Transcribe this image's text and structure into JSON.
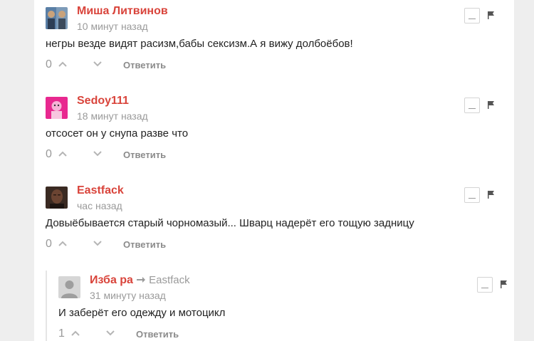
{
  "comments": [
    {
      "author": "Миша Литвинов",
      "time": "10 минут назад",
      "text": "негры везде видят расизм,бабы сексизм.А я вижу долбоёбов!",
      "score": "0",
      "reply_label": "Ответить",
      "avatar_colors": [
        "#5a7fa6",
        "#c9a27a"
      ]
    },
    {
      "author": "Sedoy111",
      "time": "18 минут назад",
      "text": "отсосет он у снупа разве что",
      "score": "0",
      "reply_label": "Ответить",
      "avatar_colors": [
        "#e8288f",
        "#f6b3d6"
      ]
    },
    {
      "author": "Eastfack",
      "time": "час назад",
      "text": "Довыёбывается старый чорномазый... Шварц надерёт его тощую задницу",
      "score": "0",
      "reply_label": "Ответить",
      "avatar_colors": [
        "#3a2a22",
        "#a07050"
      ]
    }
  ],
  "reply": {
    "author": "Изба ра",
    "parent_author": "Eastfack",
    "time": "31 минуту назад",
    "text": "И заберёт его одежду и мотоцикл",
    "score": "1",
    "reply_label": "Ответить",
    "avatar_colors": [
      "#cfcfcf",
      "#9e9e9e"
    ]
  },
  "colors": {
    "author": "#d9443b",
    "meta": "#9a9a9a",
    "background": "#eeeeee"
  },
  "icons": [
    "chevron-up-icon",
    "chevron-down-icon",
    "collapse-icon",
    "flag-icon",
    "reply-arrow-icon"
  ]
}
